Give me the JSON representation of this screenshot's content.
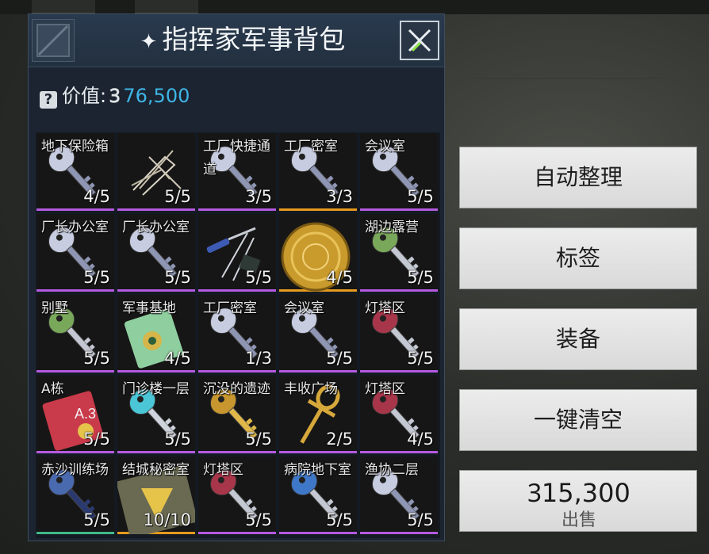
{
  "panel": {
    "title": "指挥家军事背包",
    "title_icon": "sparkle-icon",
    "value_label": "价值:",
    "currency_symbol": "Ꝫ",
    "value": "76,500"
  },
  "colors": {
    "purple": "#b45ae0",
    "orange": "#e69a1e",
    "green": "#3fb98a",
    "value_blue": "#3fb6e8"
  },
  "items": [
    {
      "name": "地下保险箱",
      "count": "4/5",
      "rarity": "purple",
      "icon": "silver-key-icon"
    },
    {
      "name": "",
      "count": "5/5",
      "rarity": "purple",
      "icon": "lockpick-wires-icon"
    },
    {
      "name": "工厂快捷通道",
      "count": "3/5",
      "rarity": "purple",
      "icon": "silver-key-icon"
    },
    {
      "name": "工厂密室",
      "count": "3/3",
      "rarity": "orange",
      "icon": "silver-key-icon"
    },
    {
      "name": "会议室",
      "count": "5/5",
      "rarity": "purple",
      "icon": "silver-key-icon"
    },
    {
      "name": "厂长办公室",
      "count": "5/5",
      "rarity": "purple",
      "icon": "silver-key-icon"
    },
    {
      "name": "厂长办公室",
      "count": "5/5",
      "rarity": "purple",
      "icon": "silver-key-icon"
    },
    {
      "name": "",
      "count": "5/5",
      "rarity": "purple",
      "icon": "screwdriver-tools-icon"
    },
    {
      "name": "",
      "count": "4/5",
      "rarity": "orange",
      "icon": "gold-disc-icon"
    },
    {
      "name": "湖边露营",
      "count": "5/5",
      "rarity": "purple",
      "icon": "green-key-icon"
    },
    {
      "name": "别墅",
      "count": "5/5",
      "rarity": "purple",
      "icon": "green-key-icon"
    },
    {
      "name": "军事基地",
      "count": "4/5",
      "rarity": "purple",
      "icon": "green-keycard-icon"
    },
    {
      "name": "工厂密室",
      "count": "1/3",
      "rarity": "purple",
      "icon": "silver-key-icon"
    },
    {
      "name": "会议室",
      "count": "5/5",
      "rarity": "purple",
      "icon": "silver-key-icon"
    },
    {
      "name": "灯塔区",
      "count": "5/5",
      "rarity": "purple",
      "icon": "red-key-icon"
    },
    {
      "name": "A栋",
      "count": "5/5",
      "rarity": "purple",
      "icon": "red-keycard-icon"
    },
    {
      "name": "门诊楼一层",
      "count": "5/5",
      "rarity": "purple",
      "icon": "cyan-key-icon"
    },
    {
      "name": "沉没的遗迹",
      "count": "5/5",
      "rarity": "purple",
      "icon": "gold-key-icon"
    },
    {
      "name": "丰收广场",
      "count": "2/5",
      "rarity": "purple",
      "icon": "gold-ankh-key-icon"
    },
    {
      "name": "灯塔区",
      "count": "4/5",
      "rarity": "purple",
      "icon": "red-key-icon"
    },
    {
      "name": "赤沙训练场",
      "count": "5/5",
      "rarity": "green",
      "icon": "ornate-blue-key-icon"
    },
    {
      "name": "结城秘密室",
      "count": "10/10",
      "rarity": "orange",
      "icon": "gold-keycard-icon"
    },
    {
      "name": "灯塔区",
      "count": "5/5",
      "rarity": "purple",
      "icon": "red-key-icon"
    },
    {
      "name": "病院地下室",
      "count": "5/5",
      "rarity": "purple",
      "icon": "blue-key-icon"
    },
    {
      "name": "渔协二层",
      "count": "5/5",
      "rarity": "purple",
      "icon": "silver-key-icon"
    }
  ],
  "actions": {
    "auto_sort": "自动整理",
    "tags": "标签",
    "equip": "装备",
    "clear_all": "一键清空",
    "sell_price": "Ꝫ15,300",
    "sell": "出售"
  }
}
